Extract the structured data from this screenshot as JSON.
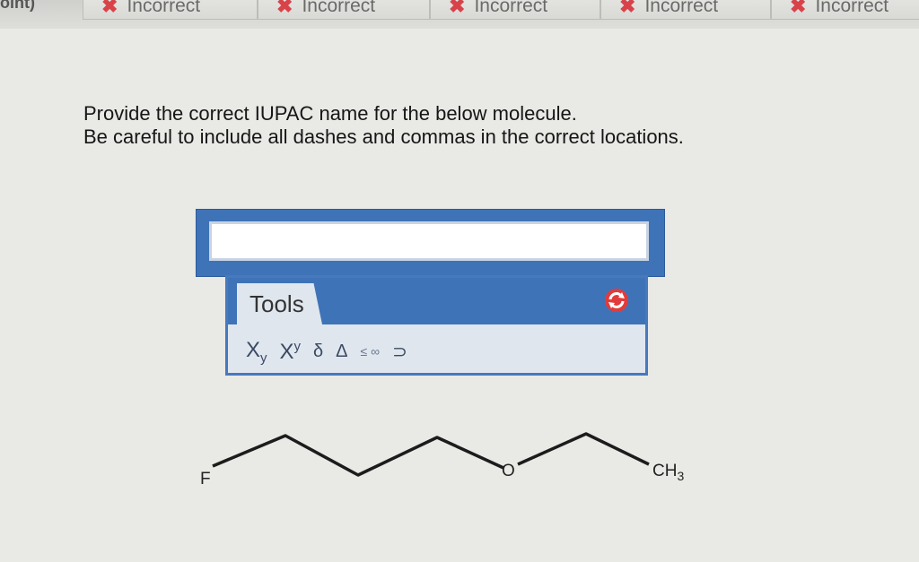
{
  "tabs": {
    "prefix": "oint)",
    "items": [
      {
        "label": "Incorrect"
      },
      {
        "label": "Incorrect"
      },
      {
        "label": "Incorrect"
      },
      {
        "label": "Incorrect"
      },
      {
        "label": "Incorrect"
      }
    ]
  },
  "question": {
    "line1": "Provide the correct IUPAC name for the below molecule.",
    "line2": "Be careful to include all dashes and commas in the correct locations."
  },
  "answer": {
    "value": "",
    "placeholder": ""
  },
  "tools": {
    "tab_label": "Tools",
    "subscript": {
      "base": "X",
      "mod": "y"
    },
    "superscript": {
      "base": "X",
      "mod": "y"
    },
    "delta_small": "δ",
    "delta_capital": "Δ",
    "leq": "≤",
    "infinity": "∞",
    "arrow": "⊃"
  },
  "molecule": {
    "atoms": {
      "fluorine": "F",
      "oxygen": "O",
      "methyl": "CH",
      "methyl_sub": "3"
    }
  },
  "colors": {
    "accent": "#3f73b8",
    "incorrect": "#d8434a",
    "panel": "#dfe6ee"
  }
}
